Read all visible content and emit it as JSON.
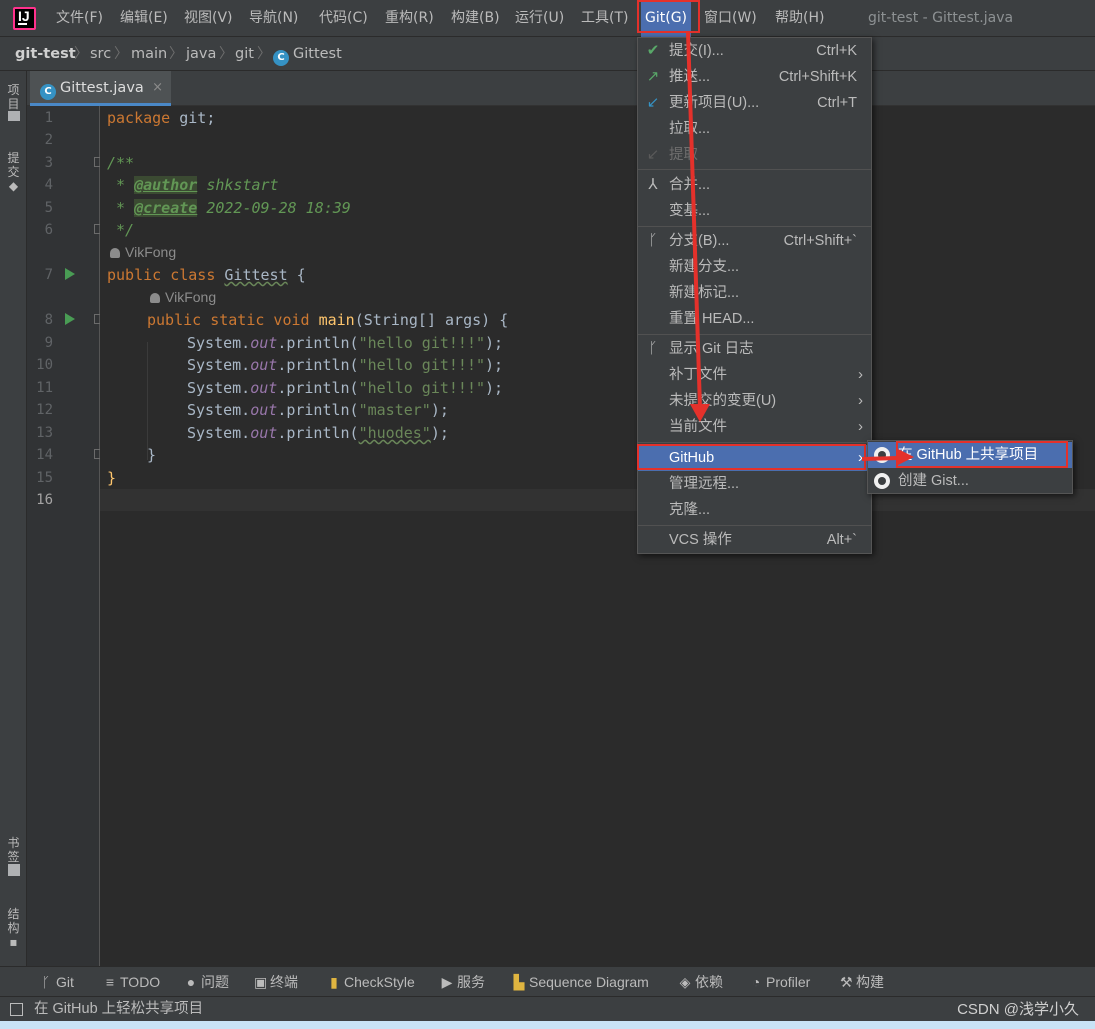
{
  "menubar": {
    "items": [
      "文件(F)",
      "编辑(E)",
      "视图(V)",
      "导航(N)",
      "代码(C)",
      "重构(R)",
      "构建(B)",
      "运行(U)",
      "工具(T)",
      "Git(G)",
      "窗口(W)",
      "帮助(H)"
    ],
    "title": "git-test - Gittest.java",
    "logo_letter": "IJ"
  },
  "breadcrumb": [
    "git-test",
    "src",
    "main",
    "java",
    "git",
    "Gittest"
  ],
  "left_strip": {
    "project": "项目",
    "commit": "提交",
    "bookmarks": "书签",
    "structure": "结构"
  },
  "tab": {
    "label": "Gittest.java",
    "close": "×",
    "icon": "C"
  },
  "editor": {
    "line_numbers": [
      "1",
      "2",
      "3",
      "4",
      "5",
      "6",
      "7",
      "8",
      "9",
      "10",
      "11",
      "12",
      "13",
      "14",
      "15",
      "16"
    ],
    "author_hint": "VikFong",
    "code": {
      "l1_kw": "package",
      "l1_rest": " git;",
      "l3": "/**",
      "l4_pre": " * ",
      "l4_tag": "@author",
      "l4_val": " shkstart",
      "l5_pre": " * ",
      "l5_tag": "@create",
      "l5_val": " 2022-09-28 18:39",
      "l6": " */",
      "l7_kw": "public class ",
      "l7_name": "Gittest",
      "l7_rest": " {",
      "l8_kw": "public static void ",
      "l8_name": "main",
      "l8_rest": "(String[] args) {",
      "println_prefix": "System.",
      "println_field": "out",
      "println_call": ".println(",
      "strings": [
        "\"hello git!!!\"",
        "\"hello git!!!\"",
        "\"hello git!!!\"",
        "\"master\"",
        "\"huodes\""
      ],
      "println_suffix": ");",
      "l14": "}",
      "l15": "}"
    }
  },
  "git_menu": {
    "commit": {
      "label": "提交(I)...",
      "shortcut": "Ctrl+K"
    },
    "push": {
      "label": "推送...",
      "shortcut": "Ctrl+Shift+K"
    },
    "update": {
      "label": "更新项目(U)...",
      "shortcut": "Ctrl+T"
    },
    "pull": "拉取...",
    "fetch": "提取",
    "merge": "合并...",
    "rebase": "变基...",
    "branches": {
      "label": "分支(B)...",
      "shortcut": "Ctrl+Shift+`"
    },
    "new_branch": "新建分支...",
    "new_tag": "新建标记...",
    "reset_head": "重置 HEAD...",
    "show_log": "显示 Git 日志",
    "patch": "补丁文件",
    "uncommitted": "未提交的变更(U)",
    "current_file": "当前文件",
    "github": "GitHub",
    "manage_remotes": "管理远程...",
    "clone": "克隆...",
    "vcs_ops": {
      "label": "VCS 操作",
      "shortcut": "Alt+`"
    }
  },
  "github_submenu": {
    "share": "在 GitHub 上共享项目",
    "gist": "创建 Gist..."
  },
  "bottom_tools": [
    "Git",
    "TODO",
    "问题",
    "终端",
    "CheckStyle",
    "服务",
    "Sequence Diagram",
    "依赖",
    "Profiler",
    "构建"
  ],
  "status": {
    "text": "在 GitHub 上轻松共享项目",
    "watermark": "CSDN @浅学小久"
  },
  "colors": {
    "selection": "#4b6eaf",
    "annotation_red": "#e4312b",
    "run_green": "#499c54"
  }
}
